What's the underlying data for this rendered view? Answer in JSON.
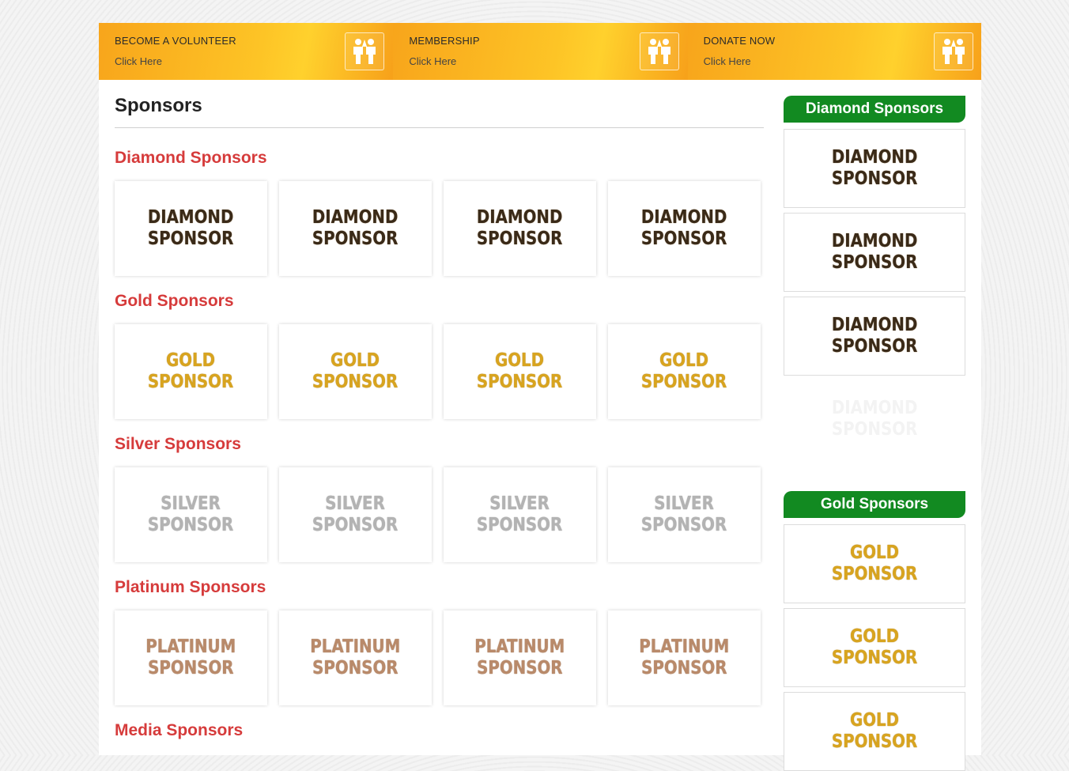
{
  "topbar": [
    {
      "title": "BECOME A VOLUNTEER",
      "sub": "Click Here",
      "icon": "people-icon"
    },
    {
      "title": "MEMBERSHIP",
      "sub": "Click Here",
      "icon": "people-icon"
    },
    {
      "title": "DONATE NOW",
      "sub": "Click Here",
      "icon": "people-icon"
    }
  ],
  "main": {
    "title": "Sponsors",
    "sections": [
      {
        "title": "Diamond Sponsors",
        "logo": [
          "DIAMOND",
          "SPONSOR"
        ]
      },
      {
        "title": "Gold Sponsors",
        "logo": [
          "GOLD",
          "SPONSOR"
        ]
      },
      {
        "title": "Silver Sponsors",
        "logo": [
          "SILVER",
          "SPONSOR"
        ]
      },
      {
        "title": "Platinum Sponsors",
        "logo": [
          "PLATINUM",
          "SPONSOR"
        ]
      },
      {
        "title": "Media Sponsors"
      }
    ]
  },
  "sidebar": {
    "diamond_title": "Diamond Sponsors",
    "gold_title": "Gold Sponsors",
    "diamond_logo": [
      "DIAMOND",
      "SPONSOR"
    ],
    "gold_logo": [
      "GOLD",
      "SPONSOR"
    ]
  },
  "colors": {
    "accent_red": "#d63b3b",
    "sidebar_green": "#128a21",
    "cta_orange": "#f8a51b"
  }
}
